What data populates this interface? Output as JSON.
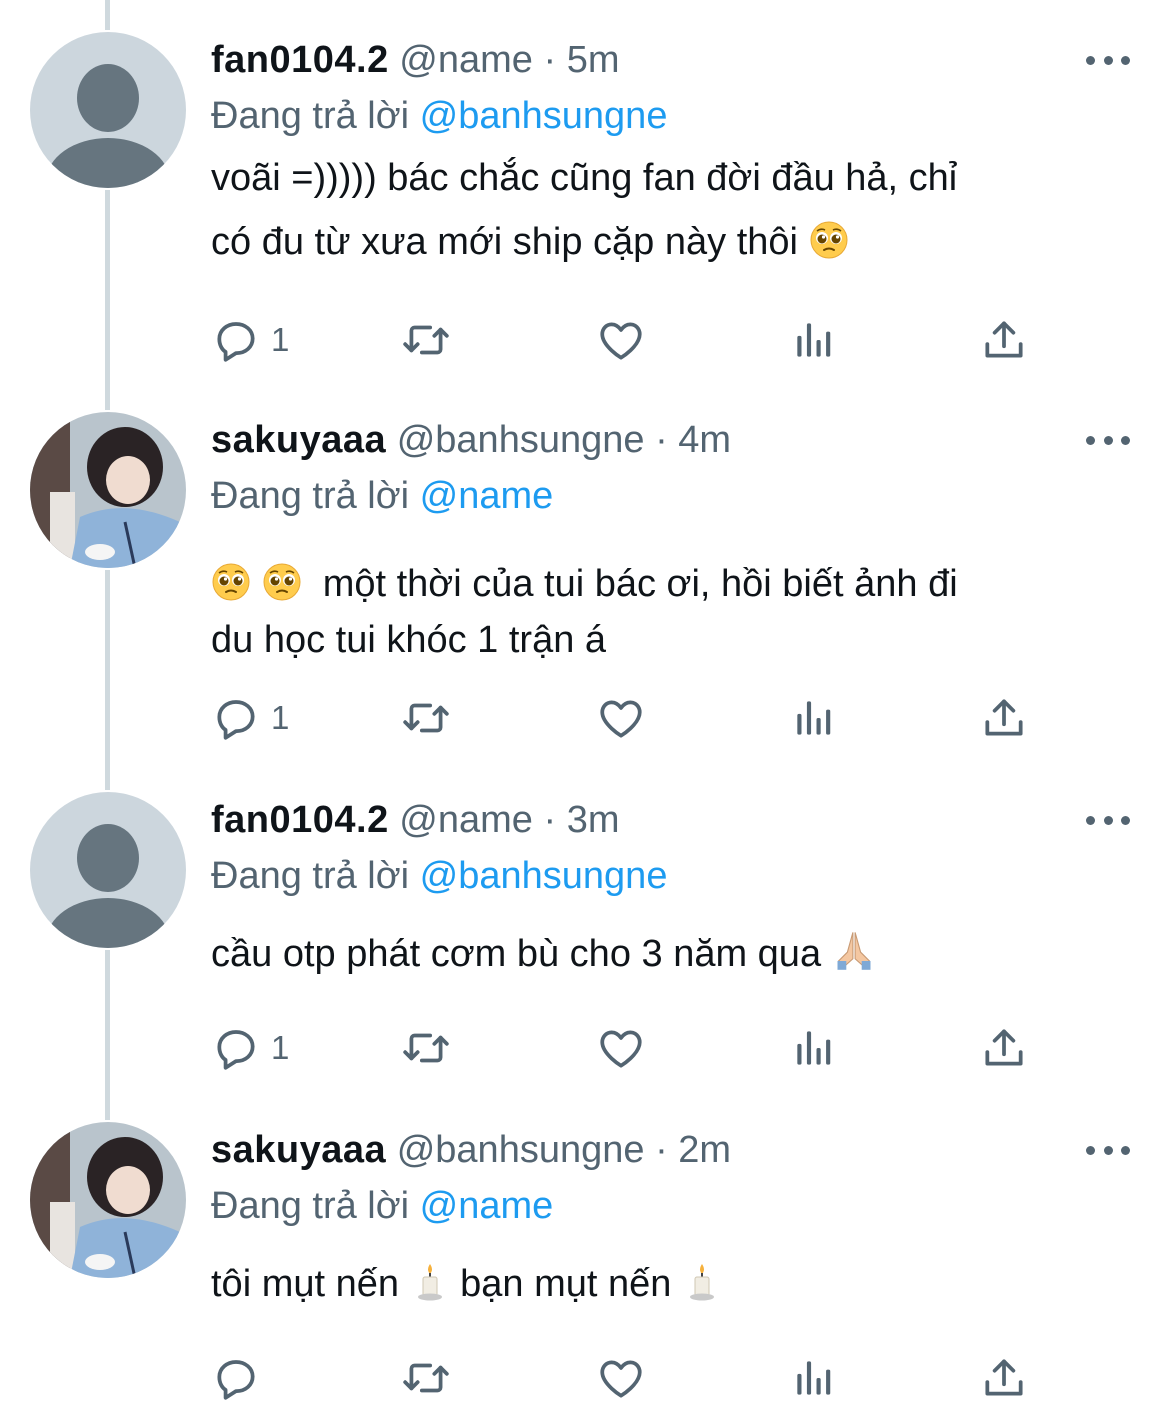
{
  "colors": {
    "accent": "#1d9bf0",
    "muted": "#536471",
    "text": "#0f1419",
    "thread_line": "#cfd9de"
  },
  "tweets": [
    {
      "display_name": "fan0104.2",
      "handle": "@name",
      "separator": "·",
      "time": "5m",
      "replying_prefix": "Đang trả lời",
      "replying_to": "@banhsungne",
      "body_lines": [
        "voãi =))))) bác chắc cũng fan đời đầu hả, chỉ",
        "có đu từ xưa mới ship cặp này thôi"
      ],
      "avatar": "default-avatar",
      "reply_count": "1"
    },
    {
      "display_name": "sakuyaaa",
      "handle": "@banhsungne",
      "separator": "·",
      "time": "4m",
      "replying_prefix": "Đang trả lời",
      "replying_to": "@name",
      "body_lines": [
        "một thời của tui bác ơi, hồi biết ảnh đi",
        "du học tui khóc 1 trận á"
      ],
      "avatar": "photo-avatar",
      "reply_count": "1"
    },
    {
      "display_name": "fan0104.2",
      "handle": "@name",
      "separator": "·",
      "time": "3m",
      "replying_prefix": "Đang trả lời",
      "replying_to": "@banhsungne",
      "body_lines": [
        "cầu otp phát cơm bù cho 3 năm qua"
      ],
      "avatar": "default-avatar",
      "reply_count": "1"
    },
    {
      "display_name": "sakuyaaa",
      "handle": "@banhsungne",
      "separator": "·",
      "time": "2m",
      "replying_prefix": "Đang trả lời",
      "replying_to": "@name",
      "body_parts": [
        "tôi mụt nến",
        "bạn mụt nến"
      ],
      "avatar": "photo-avatar",
      "reply_count": ""
    }
  ],
  "icons": {
    "more": "more-icon",
    "reply": "reply-icon",
    "retweet": "retweet-icon",
    "like": "heart-icon",
    "views": "views-icon",
    "share": "share-icon",
    "emoji_pleading": "pleading-face-emoji",
    "emoji_pray": "folded-hands-emoji",
    "emoji_candle": "candle-emoji"
  }
}
